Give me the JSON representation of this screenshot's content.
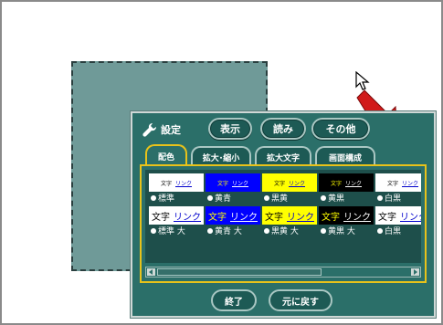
{
  "dialog": {
    "title": "設定",
    "top_buttons": [
      "表示",
      "読み",
      "その他"
    ],
    "tabs": [
      "配色",
      "拡大･縮小",
      "拡大文字",
      "画面構成"
    ],
    "swatch_text": "文字",
    "swatch_link": "リンク",
    "rows": [
      {
        "size": "small",
        "items": [
          {
            "label": "標準",
            "bg": "#ffffff",
            "text": "#000000",
            "link": "#0000cc",
            "selected": true
          },
          {
            "label": "黄青",
            "bg": "#0000ff",
            "text": "#ffff00",
            "link": "#ffffff",
            "selected": false
          },
          {
            "label": "黒黄",
            "bg": "#ffff00",
            "text": "#000000",
            "link": "#0000cc",
            "selected": false
          },
          {
            "label": "黄黒",
            "bg": "#000000",
            "text": "#ffff00",
            "link": "#ffffff",
            "selected": false
          },
          {
            "label": "白黒",
            "bg": "#ffffff",
            "text": "#000000",
            "link": "#0000cc",
            "selected": false
          }
        ]
      },
      {
        "size": "large",
        "items": [
          {
            "label": "標準 大",
            "bg": "#ffffff",
            "text": "#000000",
            "link": "#0000cc",
            "selected": false
          },
          {
            "label": "黄青 大",
            "bg": "#0000ff",
            "text": "#ffff00",
            "link": "#ffffff",
            "selected": false
          },
          {
            "label": "黒黄 大",
            "bg": "#ffff00",
            "text": "#000000",
            "link": "#0000cc",
            "selected": false
          },
          {
            "label": "黄黒 大",
            "bg": "#000000",
            "text": "#ffff00",
            "link": "#ffffff",
            "selected": false
          },
          {
            "label": "白黒",
            "bg": "#ffffff",
            "text": "#000000",
            "link": "#0000cc",
            "selected": false
          }
        ]
      }
    ],
    "bottom_buttons": [
      "終了",
      "元に戻す"
    ]
  },
  "colors": {
    "dialog_bg": "#2b6f69",
    "ghost_panel_bg": "#6f9a98",
    "active_tab_border": "#e8c21a",
    "arrow_red": "#d11a1a"
  }
}
